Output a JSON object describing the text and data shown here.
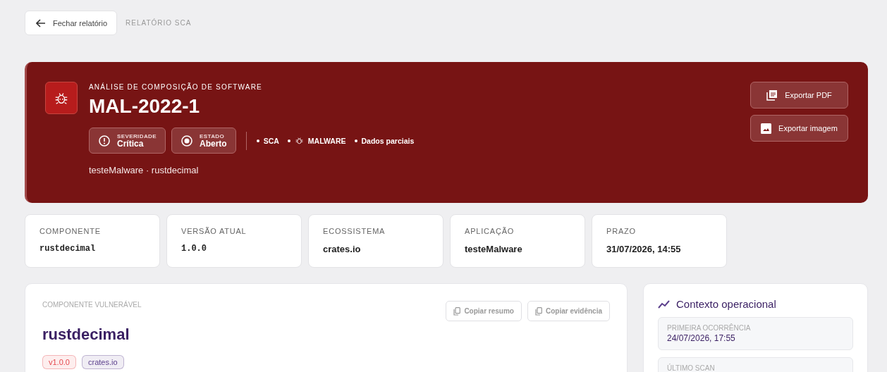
{
  "topbar": {
    "back_button": "Fechar relatório",
    "breadcrumb": "RELATÓRIO SCA"
  },
  "hero": {
    "eyebrow": "ANÁLISE DE COMPOSIÇÃO DE SOFTWARE",
    "title": "MAL-2022-1",
    "badges": [
      {
        "kind": "severity",
        "label": "SEVERIDADE",
        "value": "Crítica"
      },
      {
        "kind": "status",
        "label": "ESTADO",
        "value": "Aberto"
      }
    ],
    "tags": [
      {
        "kind": "plain",
        "label": "SCA"
      },
      {
        "kind": "bug",
        "label": "MALWARE"
      },
      {
        "kind": "plain",
        "label": "Dados parciais"
      }
    ],
    "subtitle": "testeMalware · rustdecimal",
    "actions": [
      {
        "kind": "pdf",
        "label": "Exportar PDF"
      },
      {
        "kind": "image",
        "label": "Exportar imagem"
      }
    ]
  },
  "stats": [
    {
      "kind": "code",
      "label": "COMPONENTE",
      "value": "rustdecimal"
    },
    {
      "kind": "code",
      "label": "VERSÃO ATUAL",
      "value": "1.0.0"
    },
    {
      "kind": "text",
      "label": "ECOSSISTEMA",
      "value": "crates.io"
    },
    {
      "kind": "text",
      "label": "APLICAÇÃO",
      "value": "testeMalware"
    },
    {
      "kind": "text",
      "label": "PRAZO",
      "value": "31/07/2026, 14:55"
    }
  ],
  "component": {
    "eyebrow": "COMPONENTE VULNERÁVEL",
    "name": "rustdecimal",
    "buttons": [
      "Copiar resumo",
      "Copiar evidência"
    ],
    "pills": [
      {
        "label": "v1.0.0",
        "color": "#e5484d"
      },
      {
        "label": "crates.io",
        "color": "#5b3f8c"
      }
    ]
  },
  "context": {
    "title": "Contexto operacional",
    "fields": [
      {
        "label": "PRIMEIRA OCORRÊNCIA",
        "value": "24/07/2026, 17:55"
      },
      {
        "label": "ÚLTIMO SCAN"
      }
    ]
  }
}
